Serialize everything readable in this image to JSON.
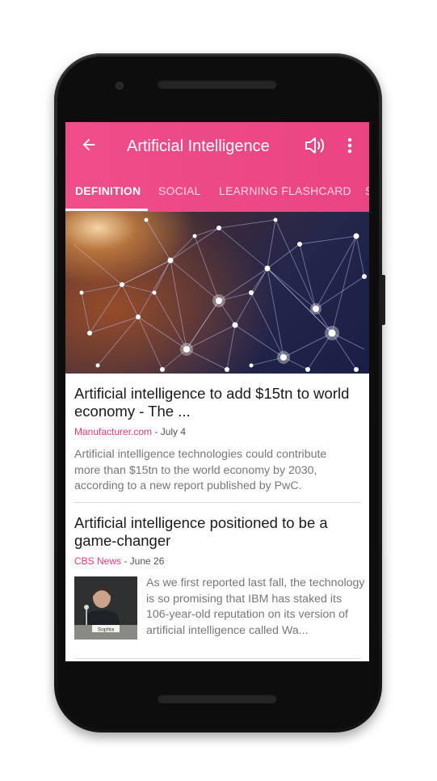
{
  "app_bar": {
    "title": "Artificial Intelligence",
    "back_icon": "arrow-left-icon",
    "sound_icon": "volume-icon",
    "more_icon": "more-vertical-icon",
    "color": "#ee4c88"
  },
  "tabs": [
    {
      "label": "DEFINITION",
      "active": true
    },
    {
      "label": "SOCIAL",
      "active": false
    },
    {
      "label": "LEARNING FLASHCARD",
      "active": false
    },
    {
      "label": "S",
      "active": false
    }
  ],
  "articles": [
    {
      "title": "Artificial intelligence to add $15tn to world economy - The ...",
      "source": "Manufacturer.com",
      "date": " - July 4",
      "snippet": "Artificial intelligence technologies could contribute more than $15tn to the world economy by 2030, according to a new report published by PwC."
    },
    {
      "title": "Artificial intelligence positioned to be a game-changer",
      "source": "CBS News",
      "date": " - June 26",
      "snippet": "As we first reported last fall, the technology is so promising that IBM has staked its 106-year-old reputation on its version of artificial intelligence called Wa..."
    }
  ],
  "accent_color": "#e73a7b"
}
